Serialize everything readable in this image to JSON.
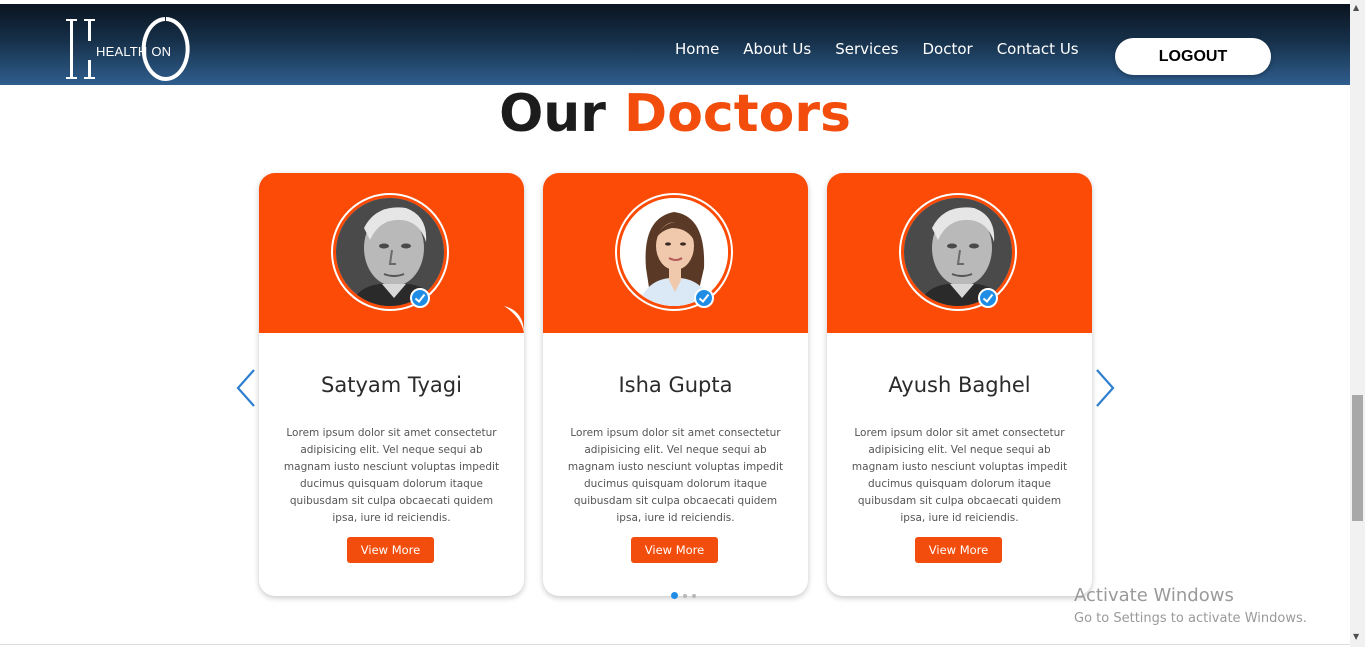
{
  "header": {
    "logo_text": "HEALTH ON",
    "nav_items": [
      "Home",
      "About Us",
      "Services",
      "Doctor",
      "Contact Us"
    ],
    "logout_label": "LOGOUT"
  },
  "section": {
    "title_part1": "Our",
    "title_part2": "Doctors"
  },
  "doctors": [
    {
      "name": "Satyam Tyagi",
      "description": "Lorem ipsum dolor sit amet consectetur adipisicing elit. Vel neque sequi ab magnam iusto nesciunt voluptas impedit ducimus quisquam dolorum itaque quibusdam sit culpa obcaecati quidem ipsa, iure id reiciendis.",
      "button_label": "View More",
      "photo_icon": "elderly-man-portrait"
    },
    {
      "name": "Isha Gupta",
      "description": "Lorem ipsum dolor sit amet consectetur adipisicing elit. Vel neque sequi ab magnam iusto nesciunt voluptas impedit ducimus quisquam dolorum itaque quibusdam sit culpa obcaecati quidem ipsa, iure id reiciendis.",
      "button_label": "View More",
      "photo_icon": "woman-portrait"
    },
    {
      "name": "Ayush Baghel",
      "description": "Lorem ipsum dolor sit amet consectetur adipisicing elit. Vel neque sequi ab magnam iusto nesciunt voluptas impedit ducimus quisquam dolorum itaque quibusdam sit culpa obcaecati quidem ipsa, iure id reiciendis.",
      "button_label": "View More",
      "photo_icon": "elderly-man-portrait"
    }
  ],
  "carousel": {
    "prev_icon": "chevron-left-icon",
    "next_icon": "chevron-right-icon",
    "page_count": 3,
    "active_page": 1
  },
  "watermark": {
    "title": "Activate Windows",
    "subtitle": "Go to Settings to activate Windows."
  },
  "colors": {
    "accent": "#f24d0c",
    "card_top": "#fb4b07",
    "nav_dark": "#0b1420",
    "nav_light": "#2f5e8e",
    "verified": "#1f8de6"
  }
}
